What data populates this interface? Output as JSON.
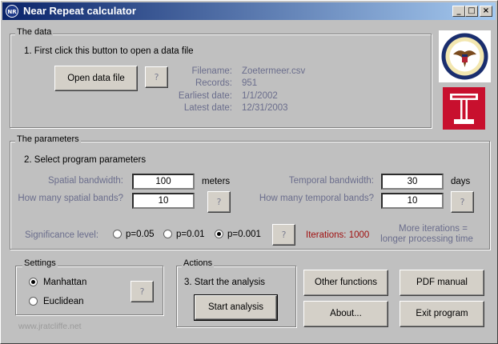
{
  "window": {
    "title": "Near Repeat calculator",
    "icon_text": "NR"
  },
  "data_group": {
    "legend": "The data",
    "instruction": "1. First click this button to open a data file",
    "open_button": "Open data file",
    "help": "?",
    "info": [
      {
        "label": "Filename:",
        "value": "Zoetermeer.csv"
      },
      {
        "label": "Records:",
        "value": "951"
      },
      {
        "label": "Earliest date:",
        "value": "1/1/2002"
      },
      {
        "label": "Latest date:",
        "value": "12/31/2003"
      }
    ]
  },
  "params_group": {
    "legend": "The parameters",
    "instruction": "2. Select program parameters",
    "spatial_bandwidth_label": "Spatial bandwidth:",
    "spatial_bandwidth_value": "100",
    "spatial_unit": "meters",
    "spatial_bands_label": "How many spatial bands?",
    "spatial_bands_value": "10",
    "temporal_bandwidth_label": "Temporal bandwidth:",
    "temporal_bandwidth_value": "30",
    "temporal_unit": "days",
    "temporal_bands_label": "How many temporal bands?",
    "temporal_bands_value": "10",
    "significance_label": "Significance level:",
    "significance_options": [
      "p=0.05",
      "p=0.01",
      "p=0.001"
    ],
    "significance_selected": "p=0.001",
    "iterations": "Iterations: 1000",
    "iterations_note_1": "More iterations =",
    "iterations_note_2": "longer processing time",
    "help": "?"
  },
  "settings_group": {
    "legend": "Settings",
    "options": [
      "Manhattan",
      "Euclidean"
    ],
    "selected": "Manhattan",
    "help": "?"
  },
  "actions_group": {
    "legend": "Actions",
    "instruction": "3. Start the analysis",
    "start_button": "Start analysis"
  },
  "buttons": {
    "other_functions": "Other functions",
    "pdf_manual": "PDF manual",
    "about": "About...",
    "exit": "Exit program"
  },
  "footer": "www.jratcliffe.net",
  "colors": {
    "title_start": "#0a246a",
    "title_end": "#a6caf0",
    "muted_text": "#6a6d8c",
    "iterations": "#a01010",
    "temple_red": "#c8102e"
  },
  "logos": {
    "seal": "doj-seal-logo",
    "temple": "temple-university-logo"
  }
}
